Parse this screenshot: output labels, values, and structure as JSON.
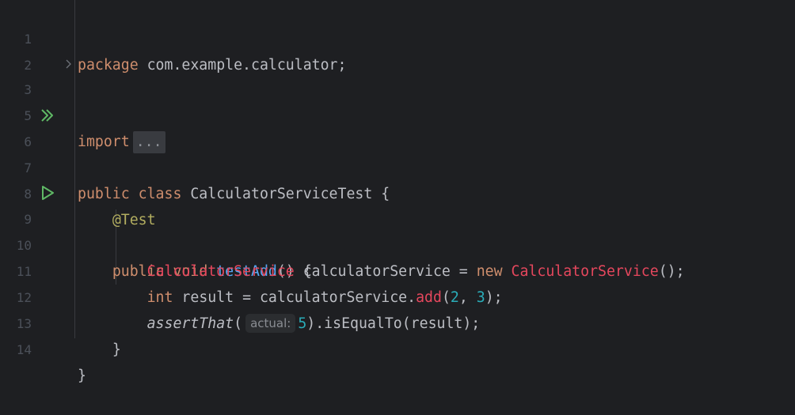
{
  "lines": [
    {
      "num": "1"
    },
    {
      "num": "2"
    },
    {
      "num": "3"
    },
    {
      "num": "5"
    },
    {
      "num": "6"
    },
    {
      "num": "7"
    },
    {
      "num": "8"
    },
    {
      "num": "9"
    },
    {
      "num": "10"
    },
    {
      "num": "11"
    },
    {
      "num": "12"
    },
    {
      "num": "13"
    },
    {
      "num": "14"
    }
  ],
  "code": {
    "l1_kw": "package",
    "l1_rest": " com.example.calculator;",
    "l3_kw": "import",
    "l3_fold": "...",
    "l6_kw1": "public",
    "l6_kw2": "class",
    "l6_rest": " CalculatorServiceTest {",
    "l8_ann": "@Test",
    "l9_kw1": "public",
    "l9_kw2": "void",
    "l9_fn": "testAdd",
    "l9_rest": "() {",
    "l10_cls1": "CalculatorService",
    "l10_mid": " calculatorService = ",
    "l10_kw": "new",
    "l10_cls2": "CalculatorService",
    "l10_end": "();",
    "l11_kw": "int",
    "l11_mid": " result = calculatorService.",
    "l11_fn": "add",
    "l11_p1": "(",
    "l11_n1": "2",
    "l11_comma": ", ",
    "l11_n2": "3",
    "l11_end": ");",
    "l12_fn": "assertThat",
    "l12_p1": "(",
    "l12_hint": "actual:",
    "l12_n": "5",
    "l12_end": ").isEqualTo(result);",
    "l13": "}",
    "l14": "}"
  },
  "colors": {
    "background": "#1e1f22",
    "keyword": "#cf8e6d",
    "class": "#e5475d",
    "function": "#56a8f5",
    "number": "#2aacb8",
    "annotation": "#b3ae60",
    "run_icon": "#5fb865"
  },
  "icons": {
    "line6": "run-all-icon",
    "line9": "run-icon",
    "line3": "fold-chevron-icon"
  }
}
